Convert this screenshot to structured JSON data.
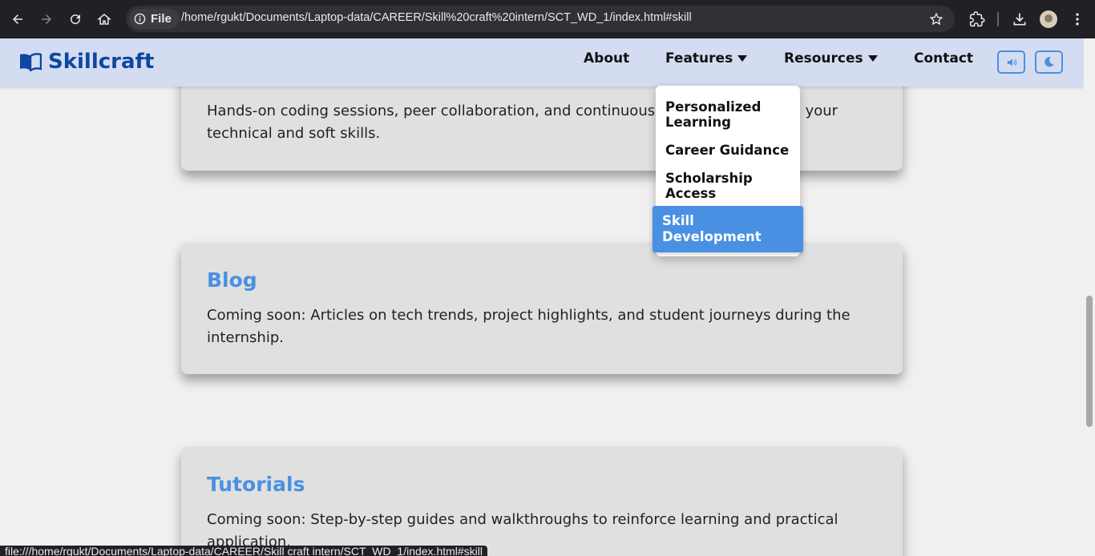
{
  "browser": {
    "scheme_label": "File",
    "url": "/home/rgukt/Documents/Laptop-data/CAREER/Skill%20craft%20intern/SCT_WD_1/index.html#skill",
    "status_url": "file:///home/rgukt/Documents/Laptop-data/CAREER/Skill craft intern/SCT_WD_1/index.html#skill"
  },
  "site": {
    "brand": "Skillcraft",
    "nav": {
      "about": "About",
      "features": "Features",
      "resources": "Resources",
      "contact": "Contact"
    },
    "features_menu": [
      "Personalized Learning",
      "Career Guidance",
      "Scholarship Access",
      "Skill Development"
    ],
    "active_menu_item": "Skill Development"
  },
  "cards": [
    {
      "title": "",
      "text": "Hands-on coding sessions, peer collaboration, and continuous learning to sharpen your technical and soft skills."
    },
    {
      "title": "Blog",
      "text": "Coming soon: Articles on tech trends, project highlights, and student journeys during the internship."
    },
    {
      "title": "Tutorials",
      "text": "Coming soon: Step-by-step guides and walkthroughs to reinforce learning and practical application."
    }
  ],
  "colors": {
    "accent": "#4a90e2",
    "brand": "#0d47a1",
    "header_bg": "#d4dcf2"
  }
}
